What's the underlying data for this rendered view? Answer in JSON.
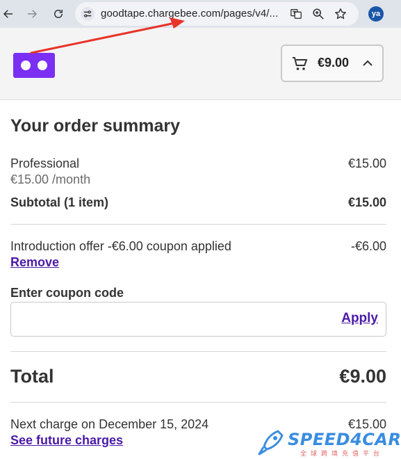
{
  "browser": {
    "url": "goodtape.chargebee.com/pages/v4/...",
    "profile_initials": "ya"
  },
  "header": {
    "cart_total": "€9.00"
  },
  "summary": {
    "title": "Your order summary",
    "plan_name": "Professional",
    "plan_price": "€15.00 /month",
    "plan_amount": "€15.00",
    "subtotal_label": "Subtotal (1 item)",
    "subtotal_value": "€15.00",
    "discount_label": "Introduction offer -€6.00 coupon applied",
    "discount_value": "-€6.00",
    "remove_label": "Remove",
    "coupon_label": "Enter coupon code",
    "coupon_value": "",
    "apply_label": "Apply",
    "total_label": "Total",
    "total_value": "€9.00",
    "next_charge_label": "Next charge on December 15, 2024",
    "next_charge_value": "€15.00",
    "future_charges_label": "See future charges"
  },
  "watermark": {
    "brand": "SPEED4CARD",
    "tagline": "全球跨境充值平台"
  },
  "colors": {
    "brand_purple": "#7b2ff2",
    "link_purple": "#4a1aa8",
    "annotation_red": "#e8332a",
    "watermark_blue": "#3a8de0"
  },
  "icons": [
    "back-arrow-icon",
    "forward-arrow-icon",
    "reload-icon",
    "site-info-icon",
    "translate-icon",
    "zoom-icon",
    "star-icon",
    "cart-icon",
    "chevron-up-icon",
    "rocket-icon"
  ]
}
